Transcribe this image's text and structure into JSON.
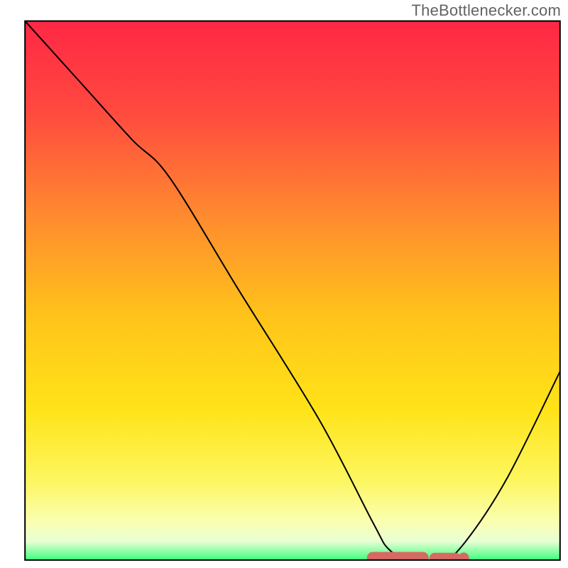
{
  "attribution": "TheBottlenecker.com",
  "chart_data": {
    "type": "line",
    "title": "",
    "xlabel": "",
    "ylabel": "",
    "xlim": [
      0,
      100
    ],
    "ylim": [
      0,
      100
    ],
    "series": [
      {
        "name": "curve",
        "x": [
          0,
          10,
          20,
          27,
          40,
          55,
          65,
          68,
          72,
          78,
          82,
          90,
          100
        ],
        "values": [
          100,
          89,
          78,
          71,
          50,
          26,
          7,
          2,
          0,
          0,
          3,
          15,
          35
        ]
      }
    ],
    "marker_band": {
      "name": "bottleneck-marker",
      "color": "#d66a63",
      "x_start": 65,
      "x_end": 82,
      "y": 0.4,
      "thickness": 2.2
    },
    "layout": {
      "plot_bbox_norm": {
        "x0": 0.044,
        "y0": 0.037,
        "x1": 0.986,
        "y1": 0.986
      },
      "gradient_stops": [
        {
          "offset": 0.0,
          "color": "#ff2745"
        },
        {
          "offset": 0.17,
          "color": "#ff4a3f"
        },
        {
          "offset": 0.36,
          "color": "#ff8a2f"
        },
        {
          "offset": 0.55,
          "color": "#ffc41a"
        },
        {
          "offset": 0.72,
          "color": "#ffe318"
        },
        {
          "offset": 0.85,
          "color": "#fdf65e"
        },
        {
          "offset": 0.93,
          "color": "#faffb1"
        },
        {
          "offset": 0.965,
          "color": "#e9ffd4"
        },
        {
          "offset": 1.0,
          "color": "#3eff7e"
        }
      ],
      "frame_stroke": "#000000",
      "curve_stroke": "#000000"
    }
  }
}
